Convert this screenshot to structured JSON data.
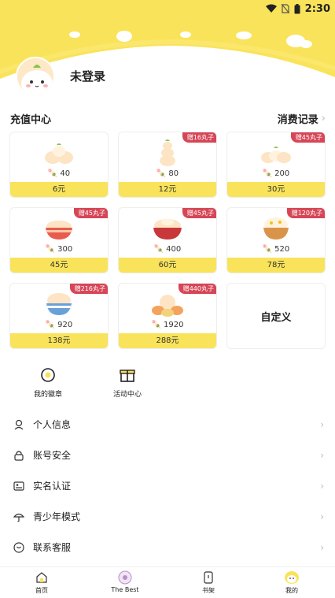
{
  "status_bar": {
    "time": "2:30"
  },
  "profile": {
    "username": "未登录"
  },
  "recharge": {
    "title": "充值中心",
    "records_label": "消费记录",
    "options": [
      {
        "amount": "40",
        "price": "6元",
        "bonus": ""
      },
      {
        "amount": "80",
        "price": "12元",
        "bonus": "赠16丸子"
      },
      {
        "amount": "200",
        "price": "30元",
        "bonus": "赠45丸子"
      },
      {
        "amount": "300",
        "price": "45元",
        "bonus": "赠45丸子"
      },
      {
        "amount": "400",
        "price": "60元",
        "bonus": "赠45丸子"
      },
      {
        "amount": "520",
        "price": "78元",
        "bonus": "赠120丸子"
      },
      {
        "amount": "920",
        "price": "138元",
        "bonus": "赠216丸子"
      },
      {
        "amount": "1920",
        "price": "288元",
        "bonus": "赠440丸子"
      }
    ],
    "custom_label": "自定义"
  },
  "quick_links": [
    {
      "label": "我的徽章",
      "icon": "badge-icon"
    },
    {
      "label": "活动中心",
      "icon": "gift-box-icon"
    }
  ],
  "menu": [
    {
      "label": "个人信息",
      "icon": "person-icon"
    },
    {
      "label": "账号安全",
      "icon": "lock-icon"
    },
    {
      "label": "实名认证",
      "icon": "id-card-icon"
    },
    {
      "label": "青少年模式",
      "icon": "umbrella-icon"
    },
    {
      "label": "联系客服",
      "icon": "heart-chat-icon"
    }
  ],
  "tabbar": [
    {
      "label": "首页",
      "icon": "home-icon"
    },
    {
      "label": "The Best",
      "icon": "the-best-icon"
    },
    {
      "label": "书架",
      "icon": "bookshelf-icon"
    },
    {
      "label": "我的",
      "icon": "mine-avatar-icon"
    }
  ],
  "colors": {
    "accent": "#f9e35a",
    "badge_red": "#d64657",
    "header_bg": "#f9e35a"
  }
}
